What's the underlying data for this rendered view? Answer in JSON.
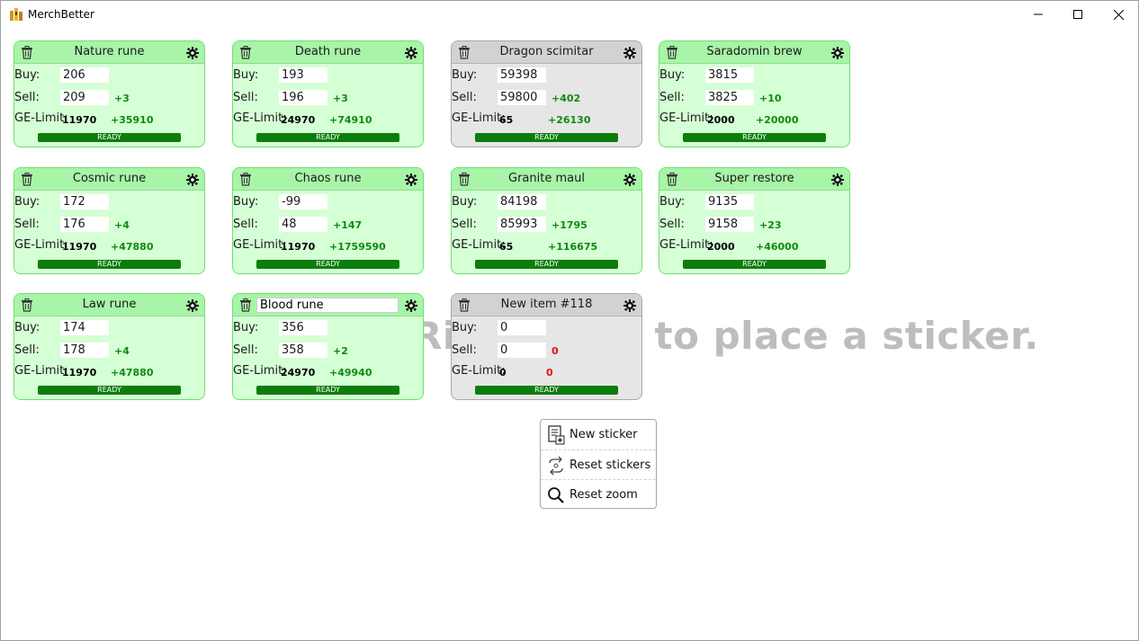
{
  "app": {
    "title": "MerchBetter"
  },
  "hint": "Right click to place a sticker.",
  "labels": {
    "buy": "Buy:",
    "sell": "Sell:",
    "ge_limit": "GE-Limit:",
    "ready": "READY"
  },
  "stickers": [
    {
      "name": "Nature rune",
      "buy": "206",
      "sell": "209",
      "diff": "+3",
      "limit": "11970",
      "profit": "+35910",
      "style": "green"
    },
    {
      "name": "Death rune",
      "buy": "193",
      "sell": "196",
      "diff": "+3",
      "limit": "24970",
      "profit": "+74910",
      "style": "green"
    },
    {
      "name": "Dragon scimitar",
      "buy": "59398",
      "sell": "59800",
      "diff": "+402",
      "limit": "65",
      "profit": "+26130",
      "style": "gray"
    },
    {
      "name": "Saradomin brew",
      "buy": "3815",
      "sell": "3825",
      "diff": "+10",
      "limit": "2000",
      "profit": "+20000",
      "style": "green"
    },
    {
      "name": "Cosmic rune",
      "buy": "172",
      "sell": "176",
      "diff": "+4",
      "limit": "11970",
      "profit": "+47880",
      "style": "green"
    },
    {
      "name": "Chaos rune",
      "buy": "-99",
      "sell": "48",
      "diff": "+147",
      "limit": "11970",
      "profit": "+1759590",
      "style": "green"
    },
    {
      "name": "Granite maul",
      "buy": "84198",
      "sell": "85993",
      "diff": "+1795",
      "limit": "65",
      "profit": "+116675",
      "style": "green"
    },
    {
      "name": "Super restore",
      "buy": "9135",
      "sell": "9158",
      "diff": "+23",
      "limit": "2000",
      "profit": "+46000",
      "style": "green"
    },
    {
      "name": "Law rune",
      "buy": "174",
      "sell": "178",
      "diff": "+4",
      "limit": "11970",
      "profit": "+47880",
      "style": "green"
    },
    {
      "name": "Blood rune",
      "buy": "356",
      "sell": "358",
      "diff": "+2",
      "limit": "24970",
      "profit": "+49940",
      "style": "green",
      "editing": true
    },
    {
      "name": "New item #118",
      "buy": "0",
      "sell": "0",
      "diff": "0",
      "limit": "0",
      "profit": "0",
      "style": "gray",
      "negative": true
    }
  ],
  "context_menu": {
    "new_sticker": "New sticker",
    "reset_stickers": "Reset stickers",
    "reset_zoom": "Reset zoom"
  },
  "colors": {
    "sticker_bg": "#d5ffd5",
    "sticker_head": "#a8f4a8",
    "gray_bg": "#e6e6e6",
    "profit": "#0e8a0e",
    "loss": "#e01010",
    "ready_bar": "#0c7d0c"
  }
}
